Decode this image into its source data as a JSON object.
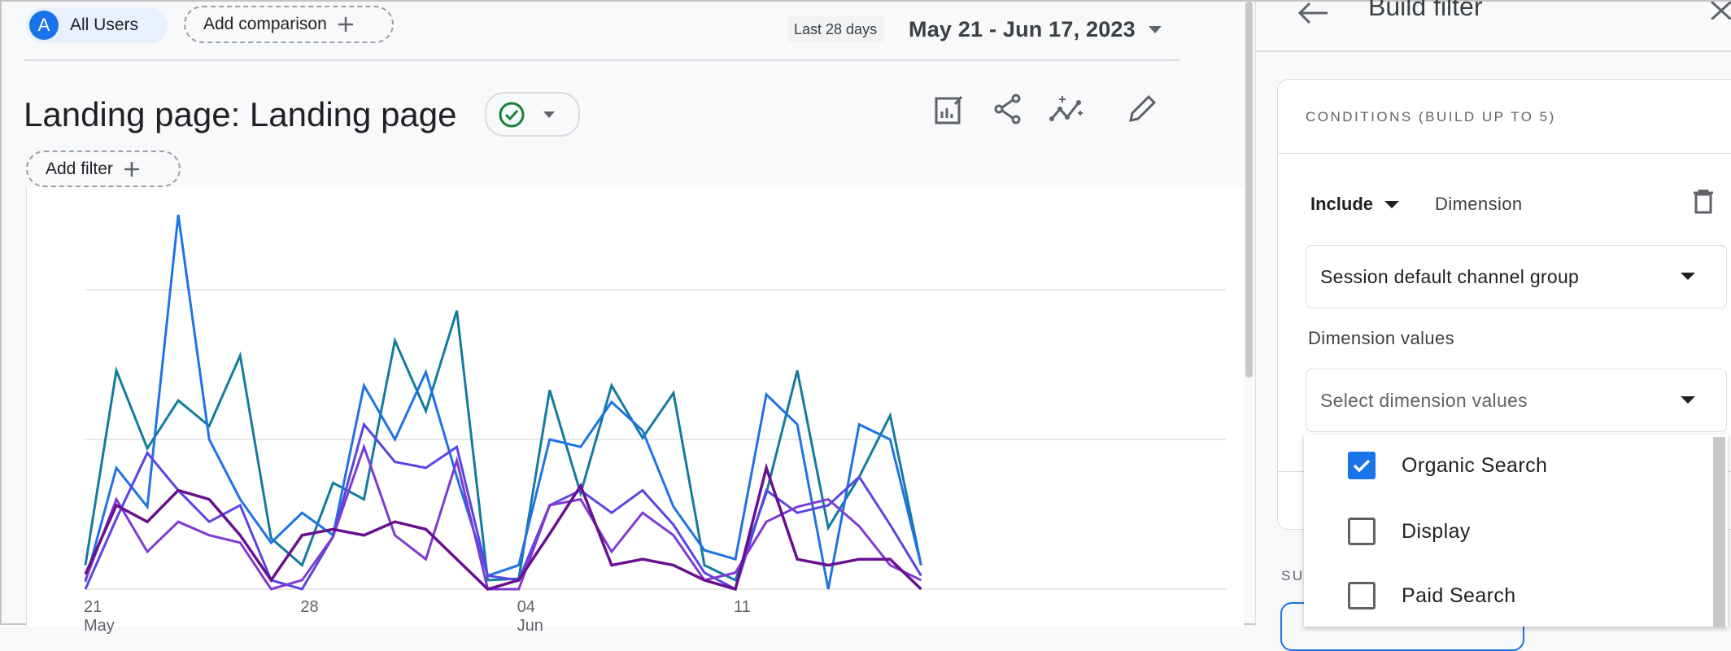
{
  "header": {
    "segment_letter": "A",
    "segment_label": "All Users",
    "add_comparison_label": "Add comparison",
    "date_preset": "Last 28 days",
    "date_range": "May 21 - Jun 17, 2023"
  },
  "report": {
    "title": "Landing page: Landing page",
    "add_filter_label": "Add filter",
    "icons": [
      "customize-report-icon",
      "share-icon",
      "insights-icon",
      "edit-icon"
    ]
  },
  "chart_data": {
    "type": "line",
    "x": [
      "May 21",
      "May 22",
      "May 23",
      "May 24",
      "May 25",
      "May 26",
      "May 27",
      "May 28",
      "May 29",
      "May 30",
      "May 31",
      "Jun 1",
      "Jun 2",
      "Jun 3",
      "Jun 4",
      "Jun 5",
      "Jun 6",
      "Jun 7",
      "Jun 8",
      "Jun 9",
      "Jun 10",
      "Jun 11",
      "Jun 12",
      "Jun 13",
      "Jun 14",
      "Jun 15",
      "Jun 16",
      "Jun 17"
    ],
    "x_ticks": [
      {
        "index": 0,
        "label": "21",
        "sub": "May"
      },
      {
        "index": 7,
        "label": "28",
        "sub": ""
      },
      {
        "index": 14,
        "label": "04",
        "sub": "Jun"
      },
      {
        "index": 21,
        "label": "11",
        "sub": ""
      }
    ],
    "ylim": [
      0,
      2.65
    ],
    "gridlines": [
      0,
      1,
      2
    ],
    "grid": true,
    "series": [
      {
        "color": "#137b9f",
        "width": 3,
        "values": [
          0.16,
          1.46,
          0.94,
          1.26,
          1.09,
          1.56,
          0.34,
          0.16,
          0.71,
          0.6,
          1.66,
          1.19,
          1.86,
          0.06,
          0.07,
          1.33,
          0.64,
          1.36,
          1.01,
          1.31,
          0.16,
          0.06,
          0.64,
          1.46,
          0.41,
          0.75,
          1.16,
          0.16
        ]
      },
      {
        "color": "#1f73e3",
        "width": 3,
        "values": [
          0.05,
          0.81,
          0.55,
          2.5,
          1.0,
          0.6,
          0.31,
          0.51,
          0.36,
          1.36,
          1.0,
          1.45,
          0.75,
          0.09,
          0.16,
          1.0,
          0.95,
          1.25,
          1.06,
          0.55,
          0.26,
          0.2,
          1.3,
          1.1,
          0.0,
          1.1,
          1.0,
          0.16
        ]
      },
      {
        "color": "#5a45e4",
        "width": 3,
        "values": [
          0.0,
          0.47,
          0.91,
          0.66,
          0.45,
          0.56,
          0.06,
          0.0,
          0.35,
          1.1,
          0.85,
          0.81,
          0.95,
          0.09,
          0.06,
          0.56,
          0.66,
          0.51,
          0.66,
          0.43,
          0.11,
          0.0,
          0.66,
          0.51,
          0.56,
          0.75,
          0.43,
          0.09
        ]
      },
      {
        "color": "#7f3bd2",
        "width": 3,
        "values": [
          0.06,
          0.6,
          0.25,
          0.45,
          0.36,
          0.31,
          0.0,
          0.06,
          0.35,
          0.95,
          0.36,
          0.2,
          0.86,
          0.0,
          0.0,
          0.56,
          0.6,
          0.25,
          0.51,
          0.36,
          0.06,
          0.11,
          0.45,
          0.55,
          0.6,
          0.42,
          0.16,
          0.06
        ]
      },
      {
        "color": "#6a108f",
        "width": 3.5,
        "values": [
          0.1,
          0.56,
          0.45,
          0.66,
          0.6,
          0.36,
          0.06,
          0.36,
          0.4,
          0.36,
          0.45,
          0.4,
          0.2,
          0.0,
          0.06,
          0.37,
          0.69,
          0.16,
          0.2,
          0.16,
          0.06,
          0.0,
          0.81,
          0.2,
          0.16,
          0.2,
          0.2,
          0.0
        ]
      }
    ]
  },
  "panel": {
    "title": "Build filter",
    "conditions_heading": "CONDITIONS (BUILD UP TO 5)",
    "include_label": "Include",
    "dimension_label": "Dimension",
    "dimension_value": "Session default channel group",
    "dimension_values_label": "Dimension values",
    "dimension_values_placeholder": "Select dimension values",
    "options": [
      {
        "label": "Organic Search",
        "checked": true
      },
      {
        "label": "Display",
        "checked": false
      },
      {
        "label": "Paid Search",
        "checked": false
      }
    ],
    "partial_heading": "SU"
  },
  "colors": {
    "accent": "#1a73e8",
    "success": "#188038"
  }
}
